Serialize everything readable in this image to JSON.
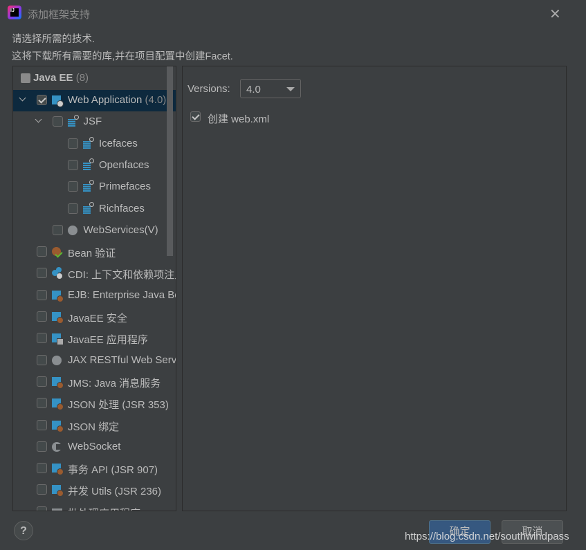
{
  "window": {
    "title": "添加框架支持",
    "close_icon": "close-icon",
    "logo": "IJ"
  },
  "description": {
    "line1": "请选择所需的技术.",
    "line2": "这将下载所有需要的库,并在项目配置中创建Facet."
  },
  "tree": {
    "header": {
      "label": "Java EE",
      "count": "(8)"
    },
    "items": [
      {
        "label": "Web Application",
        "suffix": " (4.0)",
        "level": 0,
        "expander": true,
        "checked": true,
        "selected": true,
        "icon": "web-module-icon"
      },
      {
        "label": "JSF",
        "suffix": "",
        "level": 1,
        "expander": true,
        "checked": false,
        "icon": "jsf-icon"
      },
      {
        "label": "Icefaces",
        "suffix": "",
        "level": 2,
        "checked": false,
        "icon": "jsf-icon"
      },
      {
        "label": "Openfaces",
        "suffix": "",
        "level": 2,
        "checked": false,
        "icon": "jsf-icon"
      },
      {
        "label": "Primefaces",
        "suffix": "",
        "level": 2,
        "checked": false,
        "icon": "jsf-icon"
      },
      {
        "label": "Richfaces",
        "suffix": "",
        "level": 2,
        "checked": false,
        "icon": "jsf-icon"
      },
      {
        "label": "WebServices(V)",
        "suffix": "",
        "level": 1,
        "checked": false,
        "icon": "globe-icon"
      },
      {
        "label": "Bean 验证",
        "suffix": "",
        "level": 0,
        "checked": false,
        "icon": "bean-validation-icon"
      },
      {
        "label": "CDI: 上下文和依赖项注入",
        "suffix": "",
        "level": 0,
        "checked": false,
        "icon": "cdi-icon"
      },
      {
        "label": "EJB: Enterprise Java Beans",
        "suffix": "",
        "level": 0,
        "checked": false,
        "icon": "ejb-icon"
      },
      {
        "label": "JavaEE 安全",
        "suffix": "",
        "level": 0,
        "checked": false,
        "icon": "ejb-icon"
      },
      {
        "label": "JavaEE 应用程序",
        "suffix": "",
        "level": 0,
        "checked": false,
        "icon": "javaee-app-icon"
      },
      {
        "label": "JAX RESTful Web Services",
        "suffix": "",
        "level": 0,
        "checked": false,
        "icon": "globe-icon"
      },
      {
        "label": "JMS: Java 消息服务",
        "suffix": "",
        "level": 0,
        "checked": false,
        "icon": "ejb-icon"
      },
      {
        "label": "JSON 处理 (JSR 353)",
        "suffix": "",
        "level": 0,
        "checked": false,
        "icon": "ejb-icon"
      },
      {
        "label": "JSON 绑定",
        "suffix": "",
        "level": 0,
        "checked": false,
        "icon": "ejb-icon"
      },
      {
        "label": "WebSocket",
        "suffix": "",
        "level": 0,
        "checked": false,
        "icon": "websocket-icon"
      },
      {
        "label": "事务 API (JSR 907)",
        "suffix": "",
        "level": 0,
        "checked": false,
        "icon": "ejb-icon"
      },
      {
        "label": "并发 Utils (JSR 236)",
        "suffix": "",
        "level": 0,
        "checked": false,
        "icon": "ejb-icon"
      },
      {
        "label": "批处理应用程序",
        "suffix": "",
        "level": 0,
        "checked": false,
        "icon": "folder-icon"
      }
    ]
  },
  "settings": {
    "versions_label": "Versions:",
    "version_value": "4.0",
    "create_webxml_label": "创建 web.xml",
    "create_webxml_checked": true
  },
  "footer": {
    "help": "?",
    "ok": "确定",
    "cancel": "取消"
  },
  "watermark": "https://blog.csdn.net/southwindpass",
  "colors": {
    "background": "#3c3f41",
    "selection": "#0d293e",
    "primary_button": "#365880",
    "module_blue": "#3592c4",
    "bean_brown": "#9a5b2f"
  }
}
